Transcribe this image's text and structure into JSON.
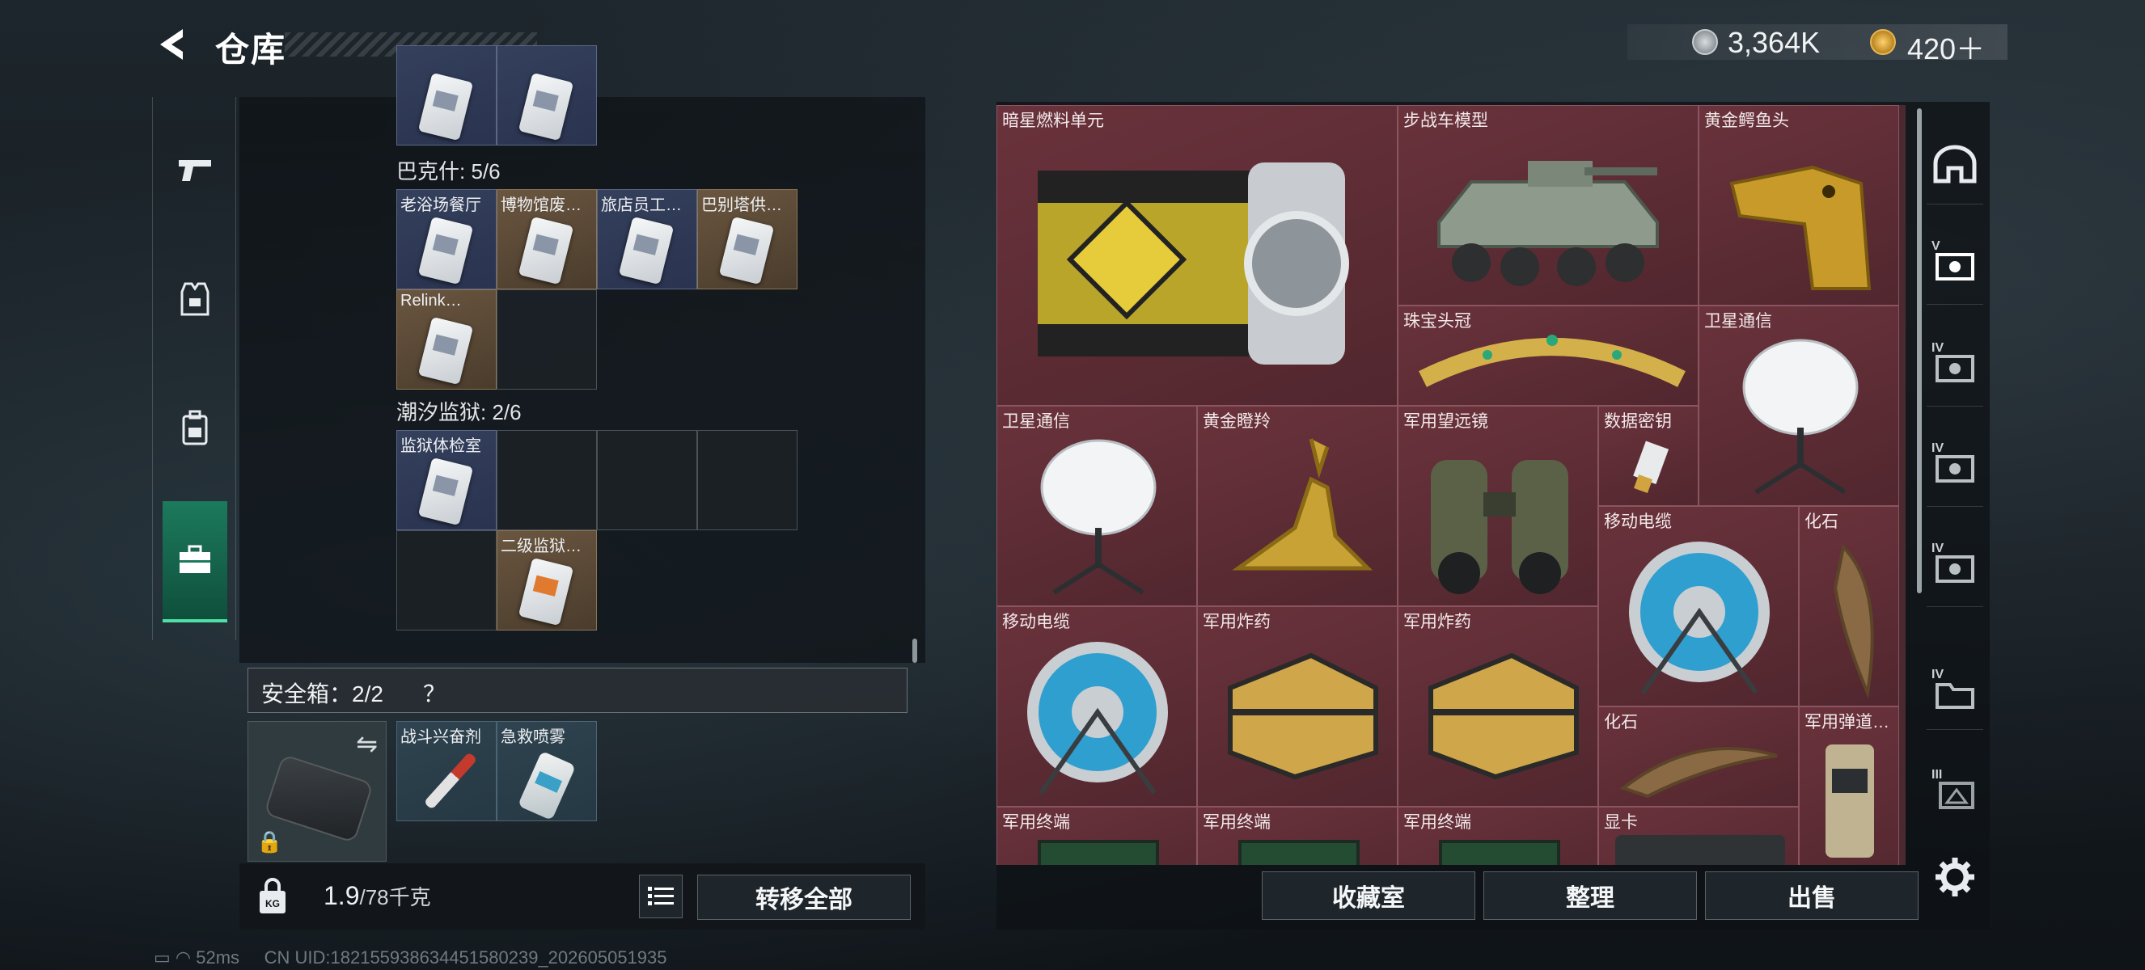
{
  "header": {
    "title": "仓库",
    "currency_silver": "3,364K",
    "currency_gold": "420＋"
  },
  "nav": {
    "tabs": [
      "weapon-icon",
      "armor-icon",
      "backpack-icon",
      "container-icon"
    ],
    "active": 3
  },
  "left": {
    "sections": [
      {
        "label": "巴克什: 5/6",
        "items": [
          "老浴场餐厅",
          "博物馆废…",
          "旅店员工…",
          "巴别塔供…",
          "Relink…"
        ]
      },
      {
        "label": "潮汐监狱: 2/6",
        "items": [
          "监狱体检室",
          "二级监狱…"
        ]
      }
    ],
    "safe_box": {
      "label": "安全箱：2/2",
      "help": "？",
      "items": [
        "战斗兴奋剂",
        "急救喷雾"
      ]
    },
    "weight": {
      "value": "1.9",
      "capacity": "/78千克"
    },
    "transfer_all": "转移全部"
  },
  "stash": {
    "items": [
      {
        "name": "暗星燃料单元"
      },
      {
        "name": "步战车模型"
      },
      {
        "name": "黄金鳄鱼头"
      },
      {
        "name": "珠宝头冠"
      },
      {
        "name": "卫星通信"
      },
      {
        "name": "卫星通信"
      },
      {
        "name": "黄金瞪羚"
      },
      {
        "name": "军用望远镜"
      },
      {
        "name": "数据密钥"
      },
      {
        "name": "移动电缆"
      },
      {
        "name": "化石"
      },
      {
        "name": "移动电缆"
      },
      {
        "name": "军用炸药"
      },
      {
        "name": "军用炸药"
      },
      {
        "name": "化石"
      },
      {
        "name": "军用弹道…"
      },
      {
        "name": "军用终端"
      },
      {
        "name": "军用终端"
      },
      {
        "name": "军用终端"
      },
      {
        "name": "显卡"
      }
    ],
    "buttons": {
      "collection": "收藏室",
      "sort": "整理",
      "sell": "出售"
    }
  },
  "side_tabs": [
    "bunker-icon",
    "V",
    "IV",
    "IV",
    "IV",
    "IV",
    "III"
  ],
  "status": {
    "ping": "52ms",
    "uid": "CN UID:1821559386344515802​39_202605051935"
  },
  "colors": {
    "accent_green": "#4fe0a5",
    "stash_red": "#52303a"
  }
}
